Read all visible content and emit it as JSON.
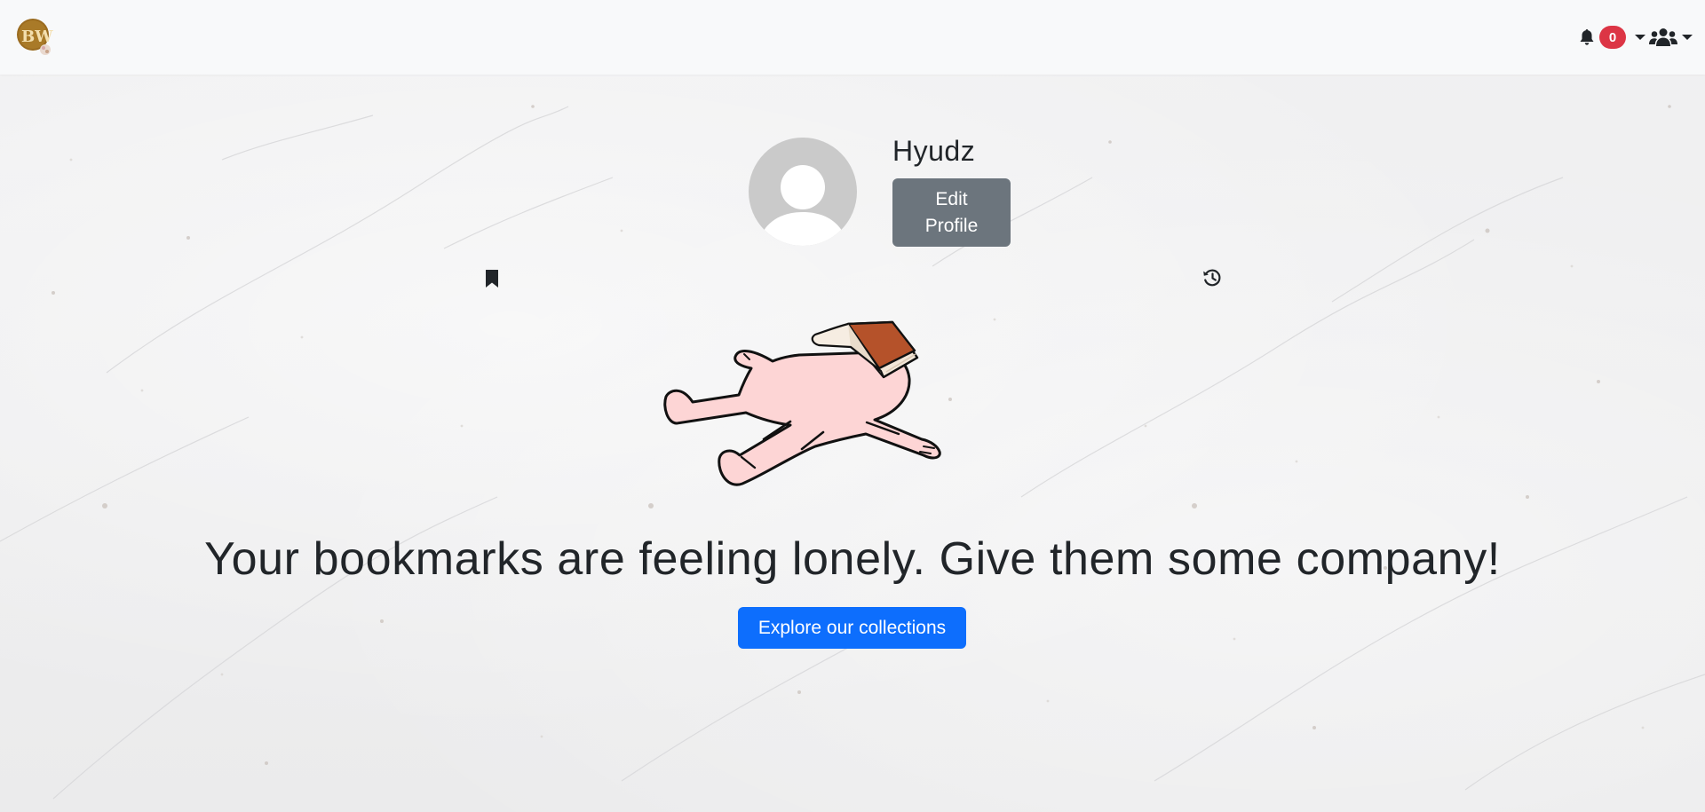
{
  "navbar": {
    "logo_text": "BW",
    "notification_count": "0",
    "icons": {
      "notifications": "bell-icon",
      "users": "users-icon",
      "dropdown": "caret-down-icon"
    }
  },
  "profile": {
    "username": "Hyudz",
    "edit_button_label": "Edit Profile",
    "avatar": "default-avatar-icon"
  },
  "tabs": [
    {
      "icon": "bookmark-icon"
    },
    {
      "icon": "history-icon"
    }
  ],
  "empty_state": {
    "message": "Your bookmarks are feeling lonely. Give them some company!",
    "cta_label": "Explore our collections"
  },
  "colors": {
    "navbar_bg": "#f8f9fa",
    "badge_bg": "#dc3545",
    "edit_button_bg": "#6c757d",
    "primary_button_bg": "#0d6efd",
    "text": "#212529"
  }
}
